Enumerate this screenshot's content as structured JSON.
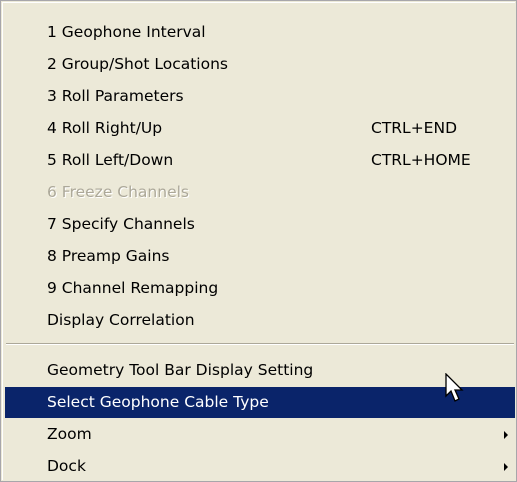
{
  "menu": {
    "items": [
      {
        "label": "1 Geophone Interval"
      },
      {
        "label": "2 Group/Shot Locations"
      },
      {
        "label": "3 Roll Parameters"
      },
      {
        "label": "4 Roll Right/Up",
        "shortcut": "CTRL+END"
      },
      {
        "label": "5 Roll Left/Down",
        "shortcut": "CTRL+HOME"
      },
      {
        "label": "6 Freeze Channels",
        "disabled": true
      },
      {
        "label": "7 Specify Channels"
      },
      {
        "label": "8 Preamp Gains"
      },
      {
        "label": "9 Channel Remapping"
      },
      {
        "label": "Display Correlation"
      }
    ],
    "items2": [
      {
        "label": "Geometry Tool Bar Display Setting"
      },
      {
        "label": "Select Geophone Cable Type",
        "highlighted": true
      },
      {
        "label": "Zoom",
        "submenu": true
      },
      {
        "label": "Dock",
        "submenu": true
      }
    ]
  },
  "colors": {
    "menu_bg": "#ece9d8",
    "highlight_bg": "#0a246a",
    "disabled_text": "#aca899"
  },
  "icons": {
    "submenu_arrow": "chevron-right-icon",
    "cursor": "mouse-pointer-icon"
  }
}
